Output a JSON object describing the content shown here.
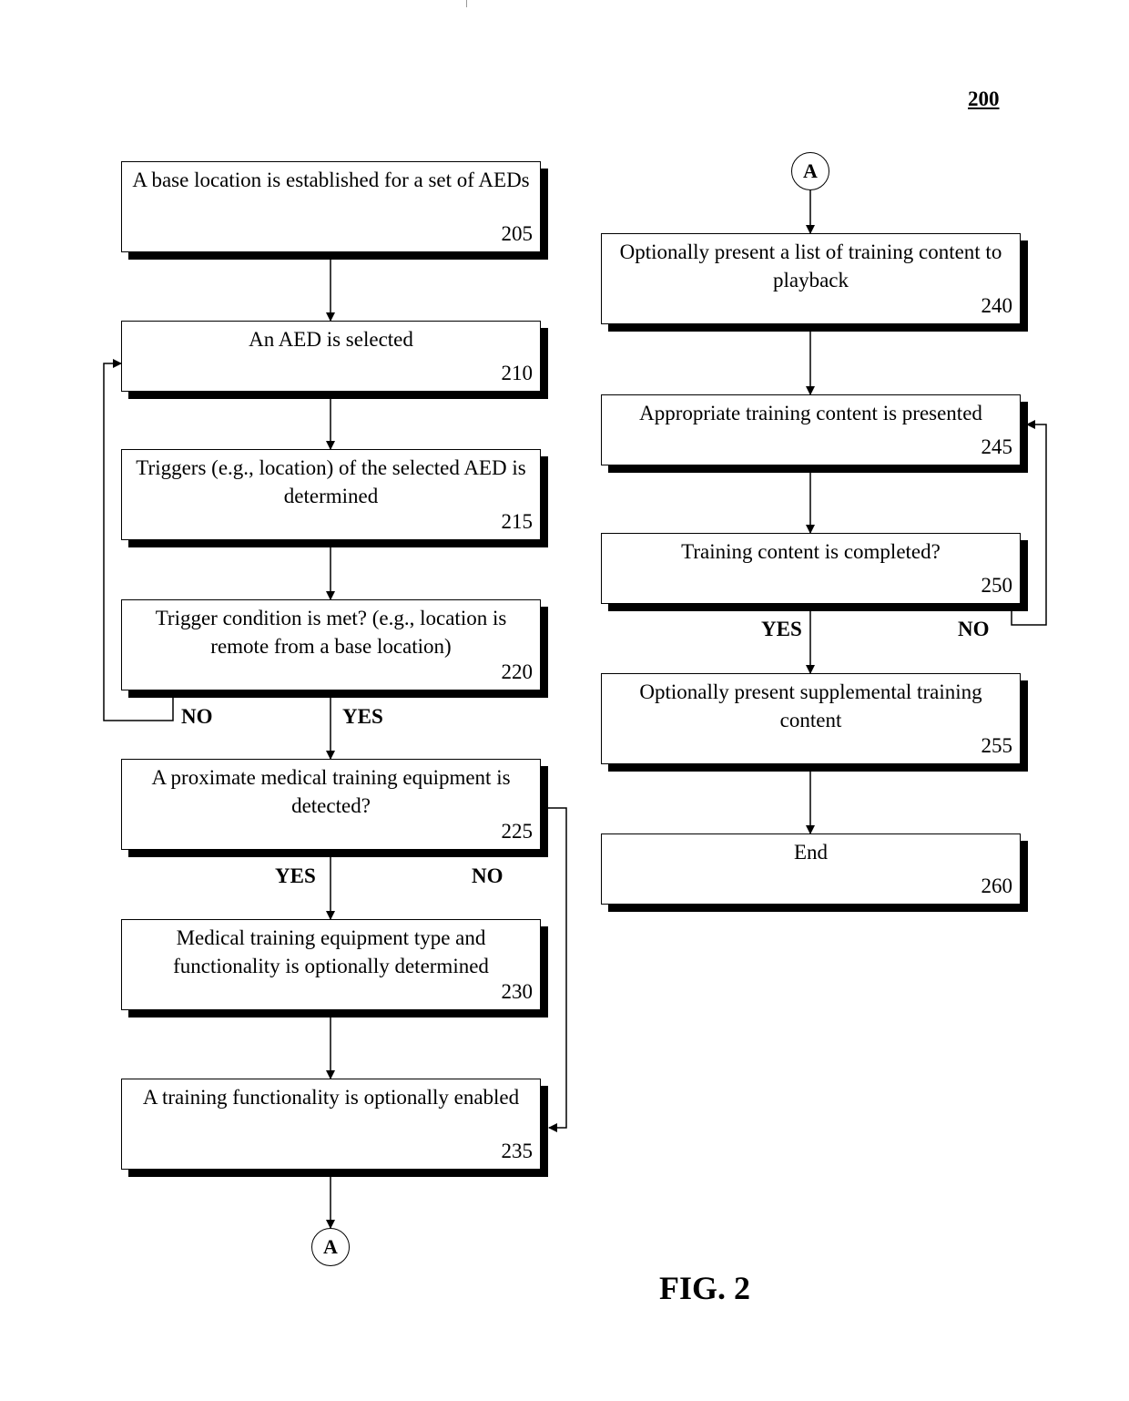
{
  "figure": {
    "reference_number": "200",
    "caption": "FIG. 2"
  },
  "steps": {
    "s205": {
      "text": "A base location is established for a set of AEDs",
      "num": "205"
    },
    "s210": {
      "text": "An AED is selected",
      "num": "210"
    },
    "s215": {
      "text": "Triggers (e.g., location) of the selected AED is determined",
      "num": "215"
    },
    "s220": {
      "text": "Trigger condition is met? (e.g., location is remote from a base location)",
      "num": "220"
    },
    "s225": {
      "text": "A proximate medical training equipment is detected?",
      "num": "225"
    },
    "s230": {
      "text": "Medical training equipment type and functionality is optionally determined",
      "num": "230"
    },
    "s235": {
      "text": "A training functionality is optionally enabled",
      "num": "235"
    },
    "s240": {
      "text": "Optionally present a list of training content to playback",
      "num": "240"
    },
    "s245": {
      "text": "Appropriate training content is presented",
      "num": "245"
    },
    "s250": {
      "text": "Training content is completed?",
      "num": "250"
    },
    "s255": {
      "text": "Optionally present supplemental training content",
      "num": "255"
    },
    "s260": {
      "text": "End",
      "num": "260"
    }
  },
  "branch_labels": {
    "s220_no": "NO",
    "s220_yes": "YES",
    "s225_yes": "YES",
    "s225_no": "NO",
    "s250_yes": "YES",
    "s250_no": "NO"
  },
  "connectors": {
    "off_page_out": "A",
    "off_page_in": "A"
  },
  "edges": [
    {
      "from": "205",
      "to": "210"
    },
    {
      "from": "210",
      "to": "215"
    },
    {
      "from": "215",
      "to": "220"
    },
    {
      "from": "220",
      "to": "225",
      "label": "YES"
    },
    {
      "from": "220",
      "to": "210",
      "label": "NO"
    },
    {
      "from": "225",
      "to": "230",
      "label": "YES"
    },
    {
      "from": "225",
      "to": "235",
      "label": "NO"
    },
    {
      "from": "230",
      "to": "235"
    },
    {
      "from": "235",
      "to": "A"
    },
    {
      "from": "A",
      "to": "240"
    },
    {
      "from": "240",
      "to": "245"
    },
    {
      "from": "245",
      "to": "250"
    },
    {
      "from": "250",
      "to": "255",
      "label": "YES"
    },
    {
      "from": "250",
      "to": "245",
      "label": "NO"
    },
    {
      "from": "255",
      "to": "260"
    }
  ]
}
